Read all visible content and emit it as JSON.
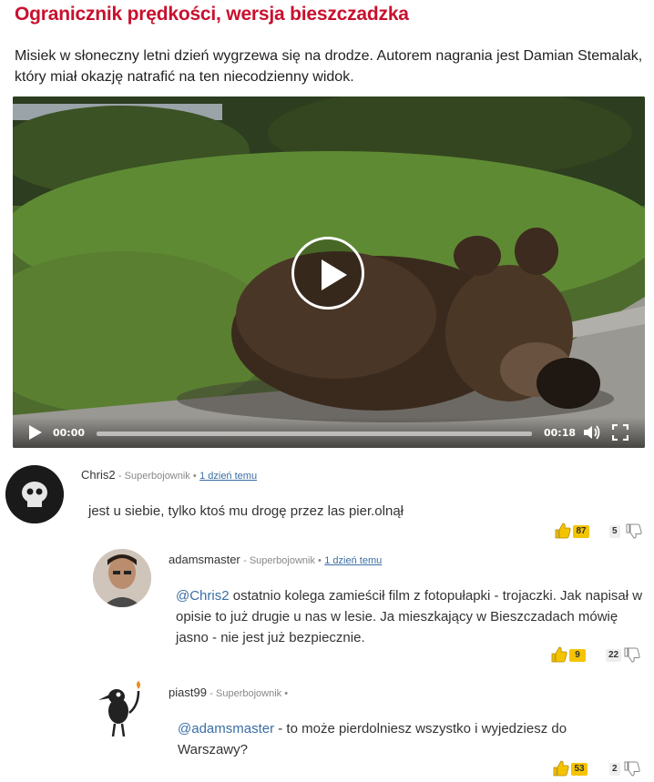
{
  "article": {
    "title": "Ogranicznik prędkości, wersja bieszczadzka",
    "lead": "Misiek w słoneczny letni dzień wygrzewa się na drodze. Autorem nagrania jest Damian Stemalak, który miał okazję natrafić na ten niecodzienny widok."
  },
  "video": {
    "current_time": "00:00",
    "duration": "00:18",
    "progress": 0,
    "icons": [
      "play-icon",
      "volume-icon",
      "fullscreen-icon"
    ]
  },
  "comments": [
    {
      "author": "Chris2",
      "rank": "Superbojownik",
      "separator": "•",
      "time": "1 dzień temu",
      "text": "jest u siebie, tylko ktoś mu drogę przez las pier.olnął",
      "upvotes": "87",
      "downvotes": "5"
    },
    {
      "author": "adamsmaster",
      "rank": "Superbojownik",
      "separator": "•",
      "time": "1 dzień temu",
      "mention": "@Chris2",
      "text": " ostatnio kolega zamieścił film z fotopułapki - trojaczki. Jak napisał w opisie to już drugie u nas w lesie. Ja mieszkający w Bieszczadach mówię jasno - nie jest już bezpiecznie.",
      "upvotes": "9",
      "downvotes": "22"
    },
    {
      "author": "piast99",
      "rank": "Superbojownik",
      "separator": "•",
      "mention": "@adamsmaster",
      "text": " - to może pierdolniesz wszystko i wyjedziesz do Warszawy?",
      "upvotes": "53",
      "downvotes": "2"
    }
  ],
  "colors": {
    "title_red": "#c8102e",
    "link_blue": "#3a6ea5",
    "upvote_yellow": "#f5c400"
  }
}
